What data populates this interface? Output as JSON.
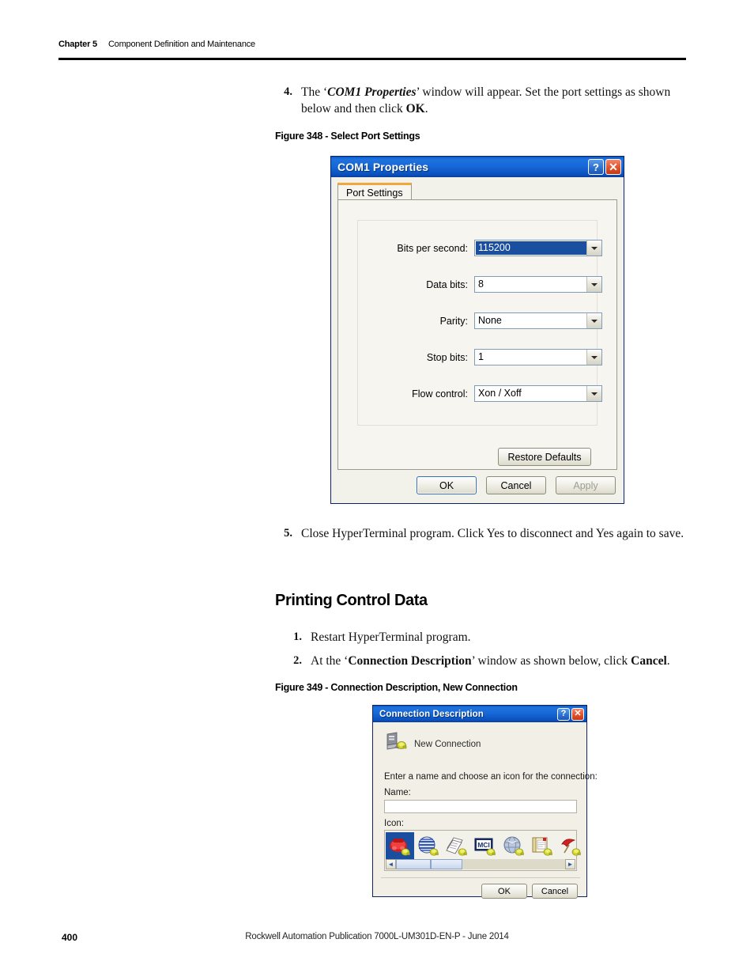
{
  "header": {
    "chapter_label": "Chapter 5",
    "chapter_title": "Component Definition and Maintenance"
  },
  "footer": {
    "page_number": "400",
    "publication": "Rockwell Automation Publication 7000L-UM301D-EN-P - June 2014"
  },
  "steps_group_1": [
    {
      "number": "4.",
      "line1_pre": "The ‘",
      "line1_emph": "COM1 Properties",
      "line1_mid": "’ window will appear. Set the port settings as shown",
      "line2_pre": "below and then click ",
      "line2_bold": "OK",
      "line2_post": "."
    },
    {
      "number": "5.",
      "line1": "Close HyperTerminal program. Click Yes to disconnect and Yes again to",
      "line2": "save."
    }
  ],
  "figure_348": {
    "caption": "Figure 348 - Select Port Settings",
    "dialog": {
      "title": "COM1 Properties",
      "help_button": "?",
      "close_button": "✕",
      "tab_label": "Port Settings",
      "fields": [
        {
          "label": "Bits per second:",
          "value": "115200",
          "selected": true
        },
        {
          "label": "Data bits:",
          "value": "8",
          "selected": false
        },
        {
          "label": "Parity:",
          "value": "None",
          "selected": false
        },
        {
          "label": "Stop bits:",
          "value": "1",
          "selected": false
        },
        {
          "label": "Flow control:",
          "value": "Xon / Xoff",
          "selected": false
        }
      ],
      "restore_defaults": "Restore Defaults",
      "ok": "OK",
      "cancel": "Cancel",
      "apply": "Apply",
      "apply_disabled": true
    }
  },
  "section_heading": "Printing Control Data",
  "steps_group_2": [
    {
      "number": "1.",
      "line1": "Restart HyperTerminal program."
    },
    {
      "number": "2.",
      "line1_pre": "At the ‘",
      "line1_bold": "Connection Description",
      "line1_mid": "’ window as shown below, click ",
      "line1_bold2": "Cancel",
      "line1_post": "."
    }
  ],
  "figure_349": {
    "caption": "Figure 349 - Connection Description, New Connection",
    "dialog": {
      "title": "Connection Description",
      "help_button": "?",
      "close_button": "✕",
      "new_connection_label": "New Connection",
      "prompt": "Enter a name and choose an icon for the connection:",
      "name_label": "Name:",
      "name_value": "",
      "icon_label": "Icon:",
      "icons": [
        {
          "name": "red-telephone-icon",
          "selected": true
        },
        {
          "name": "blue-globe-icon",
          "selected": false
        },
        {
          "name": "paper-documents-icon",
          "selected": false
        },
        {
          "name": "mci-card-icon",
          "selected": false
        },
        {
          "name": "grey-globe-icon",
          "selected": false
        },
        {
          "name": "notepad-page-icon",
          "selected": false
        },
        {
          "name": "red-umbrella-icon",
          "selected": false
        }
      ],
      "scroll_left": "◄",
      "scroll_right": "►",
      "ok": "OK",
      "cancel": "Cancel"
    }
  },
  "colors": {
    "titlebar_blue": "#1768d8",
    "selection_blue": "#1a4fa0",
    "dialog_face": "#f2f1ea",
    "tab_accent_orange": "#f0a73c",
    "close_red": "#e2562f",
    "rule_black": "#000000"
  }
}
